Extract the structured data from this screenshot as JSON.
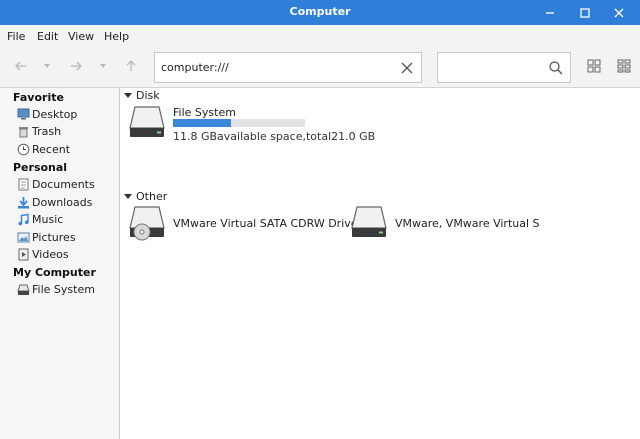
{
  "window": {
    "title": "Computer"
  },
  "menu": [
    "File",
    "Edit",
    "View",
    "Help"
  ],
  "location": {
    "path": "computer:///"
  },
  "search": {
    "placeholder": ""
  },
  "sidebar": {
    "favorite_label": "Favorite",
    "favorite": [
      {
        "label": "Desktop",
        "icon": "desktop-icon"
      },
      {
        "label": "Trash",
        "icon": "trash-icon"
      },
      {
        "label": "Recent",
        "icon": "clock-icon"
      }
    ],
    "personal_label": "Personal",
    "personal": [
      {
        "label": "Documents",
        "icon": "documents-icon"
      },
      {
        "label": "Downloads",
        "icon": "downloads-icon"
      },
      {
        "label": "Music",
        "icon": "music-icon"
      },
      {
        "label": "Pictures",
        "icon": "pictures-icon"
      },
      {
        "label": "Videos",
        "icon": "videos-icon"
      }
    ],
    "computer_label": "My Computer",
    "computer": [
      {
        "label": "File System",
        "icon": "harddisk-icon"
      }
    ]
  },
  "main": {
    "disk_group": "Disk",
    "disk": {
      "name": "File System",
      "usage_text": "11.8 GBavailable space,total21.0 GB",
      "used_fraction": 0.44
    },
    "other_group": "Other",
    "other": [
      {
        "name": "VMware Virtual SATA CDRW Drive",
        "icon": "optical-drive-icon"
      },
      {
        "name": "VMware, VMware Virtual S",
        "icon": "harddisk-icon"
      }
    ]
  },
  "colors": {
    "titlebar": "#2f7fd8",
    "accent": "#3a86d8"
  }
}
